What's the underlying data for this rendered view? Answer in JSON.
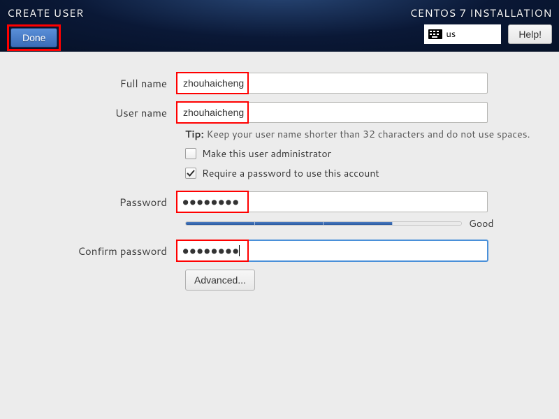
{
  "header": {
    "title": "CREATE USER",
    "right_title": "CENTOS 7 INSTALLATION",
    "done_label": "Done",
    "keyboard_layout": "us",
    "help_label": "Help!"
  },
  "form": {
    "full_name_label": "Full name",
    "full_name_value": "zhouhaicheng",
    "user_name_label": "User name",
    "user_name_value": "zhouhaicheng",
    "tip_prefix": "Tip:",
    "tip_text": "Keep your user name shorter than 32 characters and do not use spaces.",
    "admin_checkbox_label": "Make this user administrator",
    "admin_checked": false,
    "require_pw_label": "Require a password to use this account",
    "require_pw_checked": true,
    "password_label": "Password",
    "password_masked": "●●●●●●●●",
    "strength_label": "Good",
    "strength_segments_filled": 3,
    "strength_segments_total": 4,
    "confirm_label": "Confirm password",
    "confirm_masked": "●●●●●●●●",
    "advanced_label": "Advanced..."
  }
}
